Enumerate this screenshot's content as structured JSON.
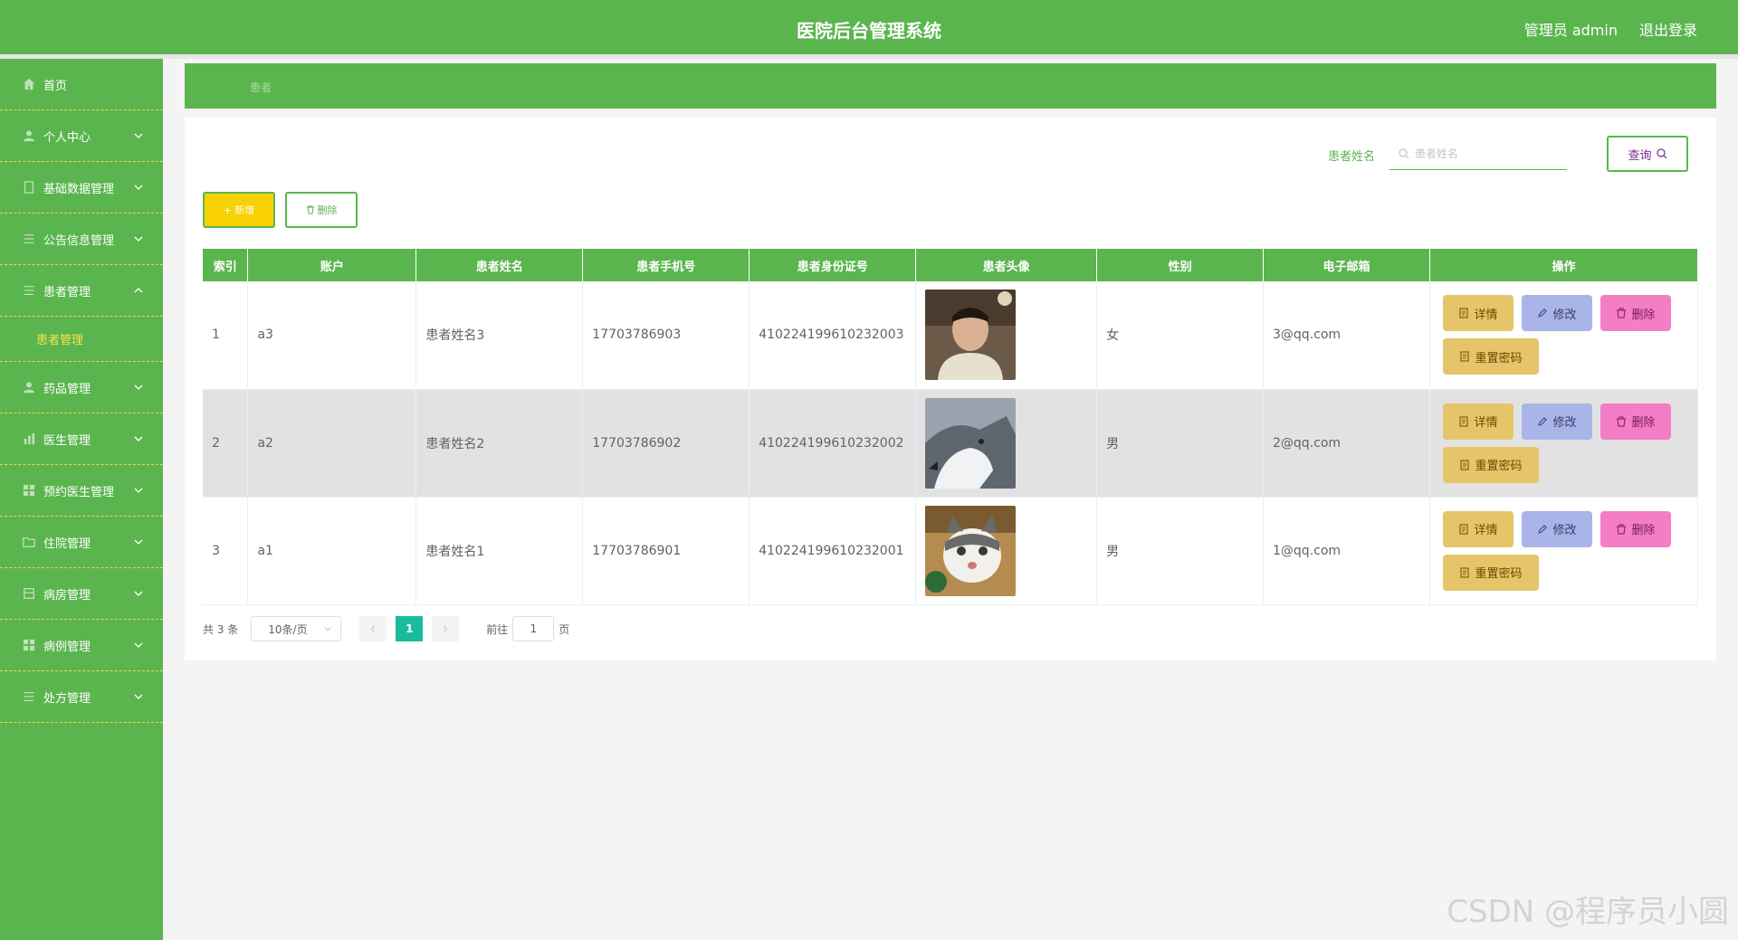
{
  "header": {
    "title": "医院后台管理系统",
    "user": "管理员 admin",
    "logout": "退出登录"
  },
  "sidebar": {
    "items": [
      {
        "label": "首页",
        "icon": "home-icon"
      },
      {
        "label": "个人中心",
        "icon": "user-icon"
      },
      {
        "label": "基础数据管理",
        "icon": "document-icon"
      },
      {
        "label": "公告信息管理",
        "icon": "list-icon"
      },
      {
        "label": "患者管理",
        "icon": "list-icon"
      },
      {
        "label": "患者管理",
        "icon": ""
      },
      {
        "label": "药品管理",
        "icon": "user-icon"
      },
      {
        "label": "医生管理",
        "icon": "chart-icon"
      },
      {
        "label": "预约医生管理",
        "icon": "grid-icon"
      },
      {
        "label": "住院管理",
        "icon": "folder-icon"
      },
      {
        "label": "病房管理",
        "icon": "box-icon"
      },
      {
        "label": "病例管理",
        "icon": "grid-icon"
      },
      {
        "label": "处方管理",
        "icon": "list-icon"
      }
    ]
  },
  "breadcrumb": {
    "label": "患者"
  },
  "search": {
    "label": "患者姓名",
    "placeholder": "患者姓名",
    "button": "查询"
  },
  "toolbar": {
    "add": "新增",
    "delete": "删除"
  },
  "table": {
    "headers": [
      "索引",
      "账户",
      "患者姓名",
      "患者手机号",
      "患者身份证号",
      "患者头像",
      "性别",
      "电子邮箱",
      "操作"
    ],
    "rows": [
      {
        "index": "1",
        "account": "a3",
        "name": "患者姓名3",
        "phone": "17703786903",
        "idcard": "410224199610232003",
        "avatar": "man-photo",
        "gender": "女",
        "email": "3@qq.com"
      },
      {
        "index": "2",
        "account": "a2",
        "name": "患者姓名2",
        "phone": "17703786902",
        "idcard": "410224199610232002",
        "avatar": "husky-photo",
        "gender": "男",
        "email": "2@qq.com"
      },
      {
        "index": "3",
        "account": "a1",
        "name": "患者姓名1",
        "phone": "17703786901",
        "idcard": "410224199610232001",
        "avatar": "cat-photo",
        "gender": "男",
        "email": "1@qq.com"
      }
    ],
    "actions": {
      "detail": "详情",
      "edit": "修改",
      "remove": "删除",
      "reset": "重置密码"
    }
  },
  "pagination": {
    "total": "共 3 条",
    "page_size": "10条/页",
    "current": "1",
    "goto_prefix": "前往",
    "goto_value": "1",
    "goto_suffix": "页"
  },
  "watermark": "CSDN @程序员小圆",
  "colors": {
    "primary": "#5bb54f",
    "accent_yellow": "#f7d103",
    "pager_active": "#1bbc9b"
  }
}
